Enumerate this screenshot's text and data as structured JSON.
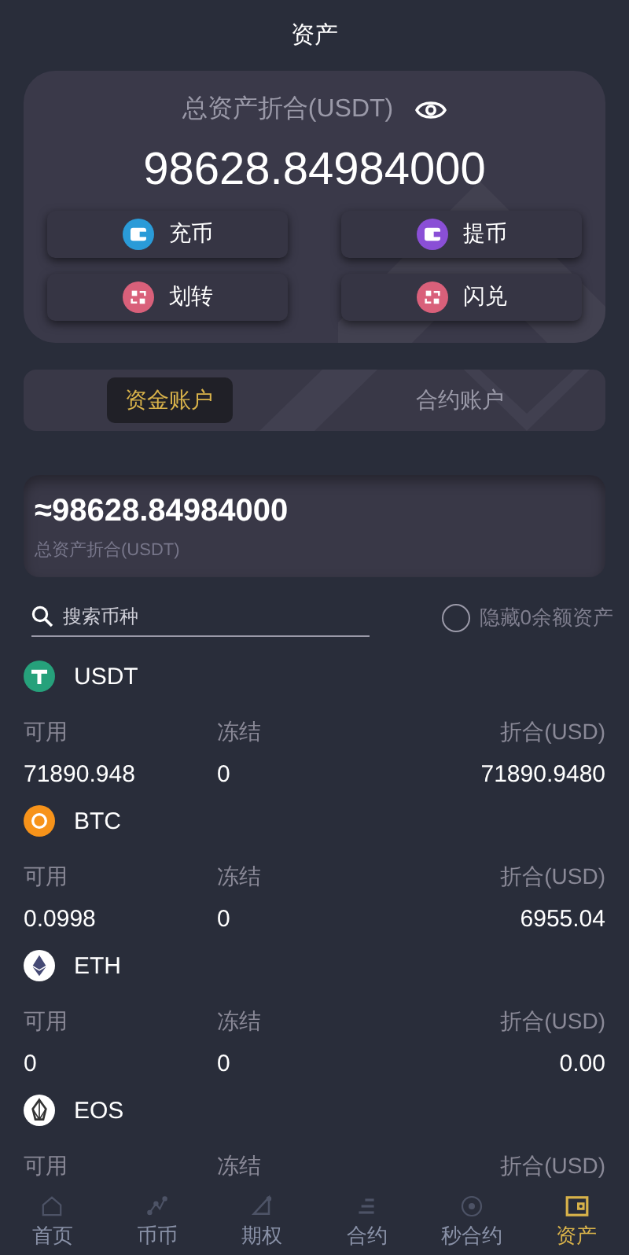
{
  "header": {
    "title": "资产"
  },
  "summary": {
    "label": "总资产折合(USDT)",
    "amount": "98628.84984000",
    "actions": [
      {
        "label": "充币",
        "kind": "deposit"
      },
      {
        "label": "提币",
        "kind": "withdraw"
      },
      {
        "label": "划转",
        "kind": "transfer"
      },
      {
        "label": "闪兑",
        "kind": "swap"
      }
    ]
  },
  "tabs": [
    {
      "label": "资金账户",
      "selected": true
    },
    {
      "label": "合约账户",
      "selected": false
    }
  ],
  "account_total": {
    "amount": "≈98628.84984000",
    "label": "总资产折合(USDT)"
  },
  "search": {
    "placeholder": "搜索币种"
  },
  "hide_zero": {
    "label": "隐藏0余额资产",
    "checked": false
  },
  "coins": [
    {
      "name": "USDT",
      "kind": "usdt",
      "labels": [
        "可用",
        "冻结",
        "折合(USD)"
      ],
      "values": [
        "71890.948",
        "0",
        "71890.9480"
      ]
    },
    {
      "name": "BTC",
      "kind": "btc",
      "labels": [
        "可用",
        "冻结",
        "折合(USD)"
      ],
      "values": [
        "0.0998",
        "0",
        "6955.04"
      ]
    },
    {
      "name": "ETH",
      "kind": "eth",
      "labels": [
        "可用",
        "冻结",
        "折合(USD)"
      ],
      "values": [
        "0",
        "0",
        "0.00"
      ]
    },
    {
      "name": "EOS",
      "kind": "eos",
      "labels": [
        "可用",
        "冻结",
        "折合(USD)"
      ]
    }
  ],
  "nav": [
    {
      "label": "首页",
      "kind": "home",
      "selected": false
    },
    {
      "label": "币币",
      "kind": "spot",
      "selected": false
    },
    {
      "label": "期权",
      "kind": "option",
      "selected": false
    },
    {
      "label": "合约",
      "kind": "contract",
      "selected": false
    },
    {
      "label": "秒合约",
      "kind": "second",
      "selected": false
    },
    {
      "label": "资产",
      "kind": "assets",
      "selected": true
    }
  ]
}
